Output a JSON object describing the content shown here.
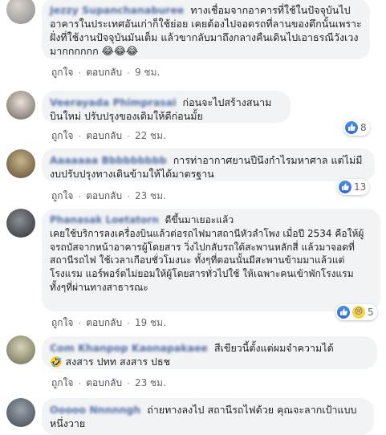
{
  "actions": {
    "like": "ถูกใจ",
    "reply": "ตอบกลับ"
  },
  "comments": [
    {
      "name": "Jezzy Supanchanaburee",
      "text": "ทางเชื่อมจากอาคารที่ใช้ในปัจจุบันไปอาคารในประเทศอันเก่าก็ใช้ย่อย เคยต้องไปจอดรถที่ลานของตึกนั้นเพราะฝั่งที่ใช้งานปัจจุบันมันเต็ม แล้วขากลับมาถึงกลางคืนเดินไปเอาธรณีวังเวงมากกกกกก",
      "emoji": "😂😂😂",
      "time": "9 ชม.",
      "reactions": null
    },
    {
      "name": "Veerayada Phimprasai",
      "text": "ก่อนจะไปสร้างสนามบินใหม่ ปรับปรุงของเดิมให้ดีก่อนมั้ย",
      "time": "22 ชม.",
      "reactions": {
        "count": "8",
        "icon": "like-icon"
      }
    },
    {
      "name": "Aaaaaaa Bbbbbbbbb",
      "text": "การท่าอากาศยานปีนึงกำไรมหาศาล แต่ไม่มีงบปรับปรุงทางเดินข้ามให้ได้มาตรฐาน",
      "time": "23 ชม.",
      "reactions": {
        "count": "13",
        "icon": "like-icon"
      }
    },
    {
      "name": "Phanasak Loetatorn",
      "text": "ดีขึ้นมาเยอะแล้ว\nเคยใช้บริการลงเครื่องบินแล้วต่อรถไฟมาสถานีหัวลำโพง เมื่อปี 2534 คือให้ผู้จรถบัสจากหน้าอาคารผู้โดยสาร วิ่งไปกลับรถใต้สะพานหลักสี่ แล้วมาจอดที่สถานีรถไฟ ใช้เวลาเกือบชั่วโมงนะ ทั้งๆที่ตอนนั้นมีสะพานข้ามมาแล้วแต่โรงแรม แอร์พอร์ตไม่ยอมให้ผู้โดยสารทั่วไปใช้ ให้เฉพาะคนเข้าพักโรงแรม ทั้งๆที่ผ่านทางสาธารณะ",
      "time": "19 ชม.",
      "reactions": {
        "count": "5",
        "icon": "like-sad-icons"
      }
    },
    {
      "name": "Com Khanpop Kaonapakaee",
      "text": "สีเขียวนี้ตั้งแต่ผมจำความได้\n🤣 สงสาร ปทท สงสาร ปธช",
      "time": "23 ชม.",
      "reactions": null
    },
    {
      "name": "Ooooo Nnnnngh",
      "text": "ถ่ายทางลงไป สถานีรถไฟด้วย คุณจะลากเป้าแบบหนึ่งวาย",
      "time": "",
      "reactions": null
    }
  ]
}
